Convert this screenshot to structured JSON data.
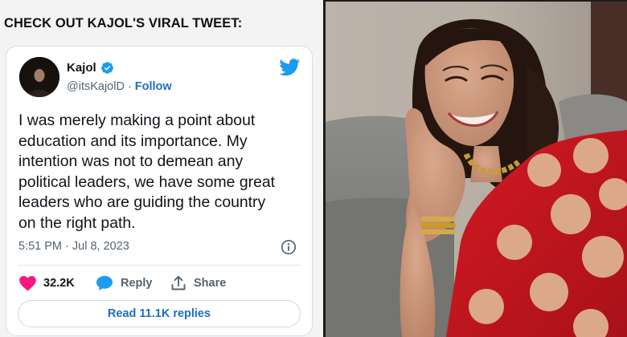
{
  "headline": "CHECK OUT KAJOL'S VIRAL TWEET:",
  "tweet": {
    "display_name": "Kajol",
    "handle": "@itsKajolD",
    "separator": "·",
    "follow_label": "Follow",
    "text": "I was merely making a point about\neducation and its importance. My\nintention was not to demean any\npolitical leaders, we have some great\nleaders who are guiding the country\non the right path.",
    "timestamp": "5:51 PM · Jul 8, 2023",
    "likes": "32.2K",
    "reply_label": "Reply",
    "share_label": "Share",
    "read_replies_label": "Read 11.1K replies"
  },
  "icons": {
    "verified": "verified-badge-icon",
    "brand": "twitter-bird-icon",
    "info": "info-icon",
    "like": "heart-icon",
    "reply": "speech-bubble-icon",
    "share": "share-icon"
  },
  "colors": {
    "accent_blue": "#1d9bf0",
    "link_blue": "#1d6fc2",
    "heart_pink": "#f91880",
    "text_dark": "#0f1419",
    "text_muted": "#536471",
    "saree_red": "#c8161d",
    "polka_dot_gold": "#dba98a"
  }
}
